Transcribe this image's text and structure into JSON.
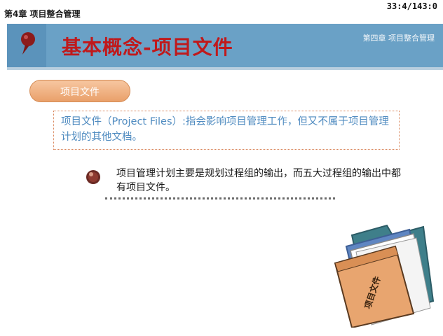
{
  "header": {
    "chapter_label": "第4章 项目整合管理",
    "slide_counter": "33:4/143:0"
  },
  "banner": {
    "title": "基本概念-项目文件",
    "subtitle": "第四章 项目整合管理",
    "icon": "pushpin-icon"
  },
  "section": {
    "pill_label": "项目文件"
  },
  "definition": {
    "text": "项目文件（Project Files）:指会影响项目管理工作，但又不属于项目管理计划的其他文档。"
  },
  "bullet": {
    "icon": "bullet-ball-icon",
    "text": "项目管理计划主要是规划过程组的输出，而五大过程组的输出中都有项目文件。"
  },
  "illustration": {
    "icon": "folder-icon",
    "label": "项目文件"
  },
  "colors": {
    "banner": "#6aa1c6",
    "title": "#c0191b",
    "pill": "#e9a06a",
    "definition_text": "#4f8bc0",
    "definition_border": "#d9855a"
  }
}
